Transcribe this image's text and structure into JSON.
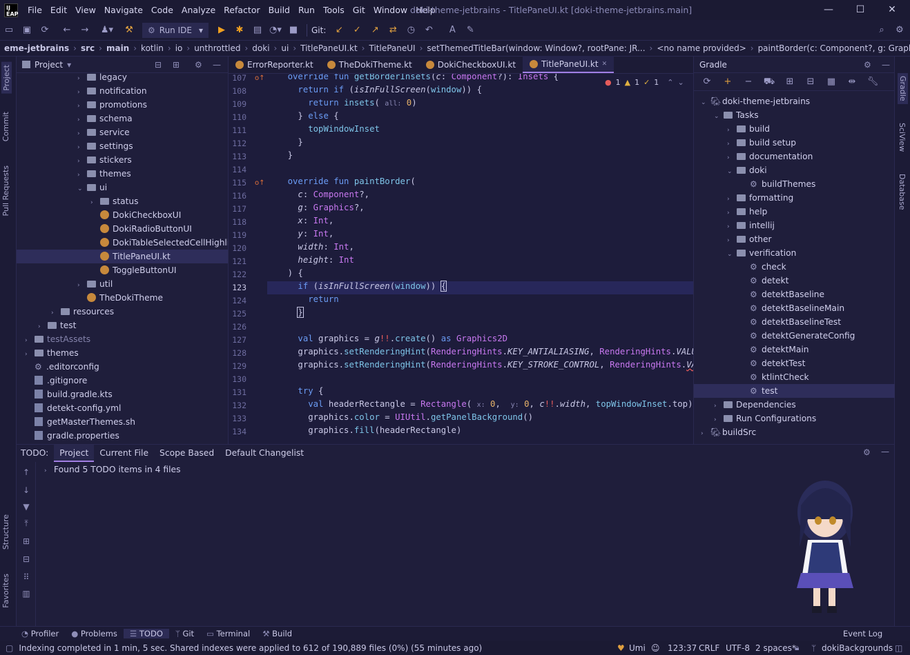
{
  "app": {
    "logo": "IJ EAP",
    "title": "doki-theme-jetbrains - TitlePaneUI.kt [doki-theme-jetbrains.main]"
  },
  "menu": [
    "File",
    "Edit",
    "View",
    "Navigate",
    "Code",
    "Analyze",
    "Refactor",
    "Build",
    "Run",
    "Tools",
    "Git",
    "Window",
    "Help"
  ],
  "toolbar": {
    "run_config": "Run IDE",
    "git_label": "Git:"
  },
  "breadcrumb": [
    "eme-jetbrains",
    "src",
    "main",
    "kotlin",
    "io",
    "unthrottled",
    "doki",
    "ui",
    "TitlePaneUI.kt",
    "TitlePaneUI",
    "setThemedTitleBar(window: Window?, rootPane: JR...",
    "<no name provided>",
    "paintBorder(c: Component?, g: Graphics?, x: Int..."
  ],
  "left_strip": [
    "Project",
    "Commit",
    "Pull Requests",
    "Structure",
    "Favorites"
  ],
  "right_strip": [
    "Gradle",
    "SciView",
    "Database"
  ],
  "project": {
    "title": "Project",
    "rows": [
      {
        "label": "legacy",
        "type": "folder",
        "indent": 4,
        "arrow": "›"
      },
      {
        "label": "notification",
        "type": "folder",
        "indent": 4,
        "arrow": "›"
      },
      {
        "label": "promotions",
        "type": "folder",
        "indent": 4,
        "arrow": "›"
      },
      {
        "label": "schema",
        "type": "folder",
        "indent": 4,
        "arrow": "›"
      },
      {
        "label": "service",
        "type": "folder",
        "indent": 4,
        "arrow": "›"
      },
      {
        "label": "settings",
        "type": "folder",
        "indent": 4,
        "arrow": "›"
      },
      {
        "label": "stickers",
        "type": "folder",
        "indent": 4,
        "arrow": "›"
      },
      {
        "label": "themes",
        "type": "folder",
        "indent": 4,
        "arrow": "›"
      },
      {
        "label": "ui",
        "type": "folder",
        "indent": 4,
        "arrow": "⌄"
      },
      {
        "label": "status",
        "type": "folder",
        "indent": 5,
        "arrow": "›"
      },
      {
        "label": "DokiCheckboxUI",
        "type": "kt",
        "indent": 5,
        "arrow": ""
      },
      {
        "label": "DokiRadioButtonUI",
        "type": "kt",
        "indent": 5,
        "arrow": ""
      },
      {
        "label": "DokiTableSelectedCellHighlightB",
        "type": "kt",
        "indent": 5,
        "arrow": ""
      },
      {
        "label": "TitlePaneUI.kt",
        "type": "kt",
        "indent": 5,
        "arrow": "",
        "selected": true
      },
      {
        "label": "ToggleButtonUI",
        "type": "kt",
        "indent": 5,
        "arrow": ""
      },
      {
        "label": "util",
        "type": "folder",
        "indent": 4,
        "arrow": "›"
      },
      {
        "label": "TheDokiTheme",
        "type": "kt",
        "indent": 4,
        "arrow": ""
      },
      {
        "label": "resources",
        "type": "folder",
        "indent": 2,
        "arrow": "›"
      },
      {
        "label": "test",
        "type": "folder",
        "indent": 1,
        "arrow": "›"
      },
      {
        "label": "testAssets",
        "type": "folder",
        "indent": 0,
        "arrow": "›",
        "dim": true
      },
      {
        "label": "themes",
        "type": "folder",
        "indent": 0,
        "arrow": "›"
      },
      {
        "label": ".editorconfig",
        "type": "gear",
        "indent": 0,
        "arrow": ""
      },
      {
        "label": ".gitignore",
        "type": "gen",
        "indent": 0,
        "arrow": ""
      },
      {
        "label": "build.gradle.kts",
        "type": "gen",
        "indent": 0,
        "arrow": ""
      },
      {
        "label": "detekt-config.yml",
        "type": "gen",
        "indent": 0,
        "arrow": ""
      },
      {
        "label": "getMasterThemes.sh",
        "type": "gen",
        "indent": 0,
        "arrow": ""
      },
      {
        "label": "gradle.properties",
        "type": "gen",
        "indent": 0,
        "arrow": ""
      }
    ]
  },
  "editor": {
    "tabs": [
      "ErrorReporter.kt",
      "TheDokiTheme.kt",
      "DokiCheckboxUI.kt",
      "TitlePaneUI.kt"
    ],
    "active_tab": 3,
    "inspections": {
      "errors": "1",
      "warnings": "1",
      "typos": "1"
    },
    "line_numbers": [
      "107",
      "108",
      "109",
      "110",
      "111",
      "112",
      "113",
      "114",
      "115",
      "116",
      "117",
      "118",
      "119",
      "120",
      "121",
      "122",
      "123",
      "124",
      "125",
      "126",
      "127",
      "128",
      "129",
      "130",
      "131",
      "132",
      "133",
      "134"
    ]
  },
  "gradle": {
    "title": "Gradle",
    "rows": [
      {
        "label": "doki-theme-jetbrains",
        "indent": 0,
        "arrow": "⌄",
        "type": "elephant"
      },
      {
        "label": "Tasks",
        "indent": 1,
        "arrow": "⌄",
        "type": "folder"
      },
      {
        "label": "build",
        "indent": 2,
        "arrow": "›",
        "type": "folder"
      },
      {
        "label": "build setup",
        "indent": 2,
        "arrow": "›",
        "type": "folder"
      },
      {
        "label": "documentation",
        "indent": 2,
        "arrow": "›",
        "type": "folder"
      },
      {
        "label": "doki",
        "indent": 2,
        "arrow": "⌄",
        "type": "folder"
      },
      {
        "label": "buildThemes",
        "indent": 3,
        "arrow": "",
        "type": "gear"
      },
      {
        "label": "formatting",
        "indent": 2,
        "arrow": "›",
        "type": "folder"
      },
      {
        "label": "help",
        "indent": 2,
        "arrow": "›",
        "type": "folder"
      },
      {
        "label": "intellij",
        "indent": 2,
        "arrow": "›",
        "type": "folder"
      },
      {
        "label": "other",
        "indent": 2,
        "arrow": "›",
        "type": "folder"
      },
      {
        "label": "verification",
        "indent": 2,
        "arrow": "⌄",
        "type": "folder"
      },
      {
        "label": "check",
        "indent": 3,
        "arrow": "",
        "type": "gear"
      },
      {
        "label": "detekt",
        "indent": 3,
        "arrow": "",
        "type": "gear"
      },
      {
        "label": "detektBaseline",
        "indent": 3,
        "arrow": "",
        "type": "gear"
      },
      {
        "label": "detektBaselineMain",
        "indent": 3,
        "arrow": "",
        "type": "gear"
      },
      {
        "label": "detektBaselineTest",
        "indent": 3,
        "arrow": "",
        "type": "gear"
      },
      {
        "label": "detektGenerateConfig",
        "indent": 3,
        "arrow": "",
        "type": "gear"
      },
      {
        "label": "detektMain",
        "indent": 3,
        "arrow": "",
        "type": "gear"
      },
      {
        "label": "detektTest",
        "indent": 3,
        "arrow": "",
        "type": "gear"
      },
      {
        "label": "ktlintCheck",
        "indent": 3,
        "arrow": "",
        "type": "gear"
      },
      {
        "label": "test",
        "indent": 3,
        "arrow": "",
        "type": "gear",
        "selected": true
      },
      {
        "label": "Dependencies",
        "indent": 1,
        "arrow": "›",
        "type": "folder"
      },
      {
        "label": "Run Configurations",
        "indent": 1,
        "arrow": "›",
        "type": "folder"
      },
      {
        "label": "buildSrc",
        "indent": 0,
        "arrow": "›",
        "type": "elephant"
      }
    ]
  },
  "todo": {
    "label": "TODO:",
    "tabs": [
      "Project",
      "Current File",
      "Scope Based",
      "Default Changelist"
    ],
    "active_tab": 0,
    "summary": "Found 5 TODO items in 4 files"
  },
  "bottom_tools": [
    "Profiler",
    "Problems",
    "TODO",
    "Git",
    "Terminal",
    "Build"
  ],
  "event_log": "Event Log",
  "status": {
    "message": "Indexing completed in 1 min, 5 sec. Shared indexes were applied to 612 of 190,889 files (0%) (55 minutes ago)",
    "theme": "Umi",
    "position": "123:37",
    "line_sep": "CRLF",
    "encoding": "UTF-8",
    "indent": "2 spaces*",
    "branch": "dokiBackgrounds"
  },
  "colors": {
    "accent": "#a17fe4",
    "bg": "#1e1d3a",
    "keyword": "#6b9cf5",
    "type": "#c878f0"
  }
}
